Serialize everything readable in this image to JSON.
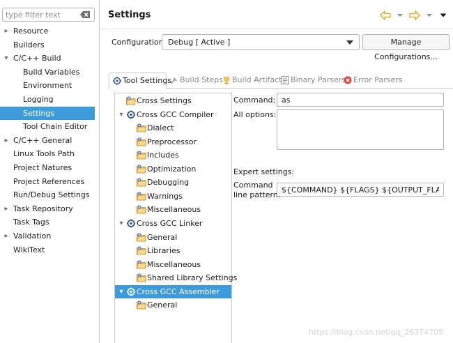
{
  "filter": {
    "placeholder": "type filter text"
  },
  "nav": {
    "items": [
      {
        "label": "Resource",
        "expandable": true,
        "indent": 0
      },
      {
        "label": "Builders",
        "expandable": false,
        "indent": 0
      },
      {
        "label": "C/C++ Build",
        "expandable": true,
        "expanded": true,
        "indent": 0
      },
      {
        "label": "Build Variables",
        "expandable": false,
        "indent": 1
      },
      {
        "label": "Environment",
        "expandable": false,
        "indent": 1
      },
      {
        "label": "Logging",
        "expandable": false,
        "indent": 1
      },
      {
        "label": "Settings",
        "expandable": false,
        "indent": 1,
        "selected": true
      },
      {
        "label": "Tool Chain Editor",
        "expandable": false,
        "indent": 1
      },
      {
        "label": "C/C++ General",
        "expandable": true,
        "indent": 0
      },
      {
        "label": "Linux Tools Path",
        "expandable": false,
        "indent": 0
      },
      {
        "label": "Project Natures",
        "expandable": false,
        "indent": 0
      },
      {
        "label": "Project References",
        "expandable": false,
        "indent": 0
      },
      {
        "label": "Run/Debug Settings",
        "expandable": false,
        "indent": 0
      },
      {
        "label": "Task Repository",
        "expandable": true,
        "indent": 0
      },
      {
        "label": "Task Tags",
        "expandable": false,
        "indent": 0
      },
      {
        "label": "Validation",
        "expandable": true,
        "indent": 0
      },
      {
        "label": "WikiText",
        "expandable": false,
        "indent": 0
      }
    ]
  },
  "header": {
    "title": "Settings"
  },
  "configuration": {
    "label": "Configuration:",
    "value": "Debug  [ Active ]",
    "manage_button": "Manage Configurations..."
  },
  "tabs": [
    {
      "label": "Tool Settings",
      "active": true,
      "icon": "tool-settings-icon"
    },
    {
      "label": "Build Steps",
      "active": false,
      "icon": "build-steps-icon"
    },
    {
      "label": "Build Artifact",
      "active": false,
      "icon": "build-artifact-icon"
    },
    {
      "label": "Binary Parsers",
      "active": false,
      "icon": "binary-parsers-icon"
    },
    {
      "label": "Error Parsers",
      "active": false,
      "icon": "error-parsers-icon"
    }
  ],
  "tool_tree": [
    {
      "label": "Cross Settings",
      "level": 0,
      "type": "option",
      "twisty": ""
    },
    {
      "label": "Cross GCC Compiler",
      "level": 0,
      "type": "tool",
      "twisty": "open"
    },
    {
      "label": "Dialect",
      "level": 1,
      "type": "option"
    },
    {
      "label": "Preprocessor",
      "level": 1,
      "type": "option"
    },
    {
      "label": "Includes",
      "level": 1,
      "type": "option"
    },
    {
      "label": "Optimization",
      "level": 1,
      "type": "option"
    },
    {
      "label": "Debugging",
      "level": 1,
      "type": "option"
    },
    {
      "label": "Warnings",
      "level": 1,
      "type": "option"
    },
    {
      "label": "Miscellaneous",
      "level": 1,
      "type": "option"
    },
    {
      "label": "Cross GCC Linker",
      "level": 0,
      "type": "tool",
      "twisty": "open"
    },
    {
      "label": "General",
      "level": 1,
      "type": "option"
    },
    {
      "label": "Libraries",
      "level": 1,
      "type": "option"
    },
    {
      "label": "Miscellaneous",
      "level": 1,
      "type": "option"
    },
    {
      "label": "Shared Library Settings",
      "level": 1,
      "type": "option"
    },
    {
      "label": "Cross GCC Assembler",
      "level": 0,
      "type": "tool",
      "twisty": "open",
      "selected": true
    },
    {
      "label": "General",
      "level": 1,
      "type": "option"
    }
  ],
  "settings": {
    "command_label": "Command:",
    "command_value": "as",
    "all_options_label": "All options:",
    "all_options_value": "",
    "expert_label": "Expert settings:",
    "pattern_label_line1": "Command",
    "pattern_label_line2": "line pattern:",
    "pattern_value": "${COMMAND} ${FLAGS} ${OUTPUT_FLAG} ${OUTPUT_PREFIX}${OUTPUT} ${INPUTS}"
  },
  "watermark": "https://blog.csdn.net/qq_26374705",
  "colors": {
    "selection": "#3d9bdc",
    "accent_arrow": "#e8a317",
    "folder": "#f0a830"
  }
}
